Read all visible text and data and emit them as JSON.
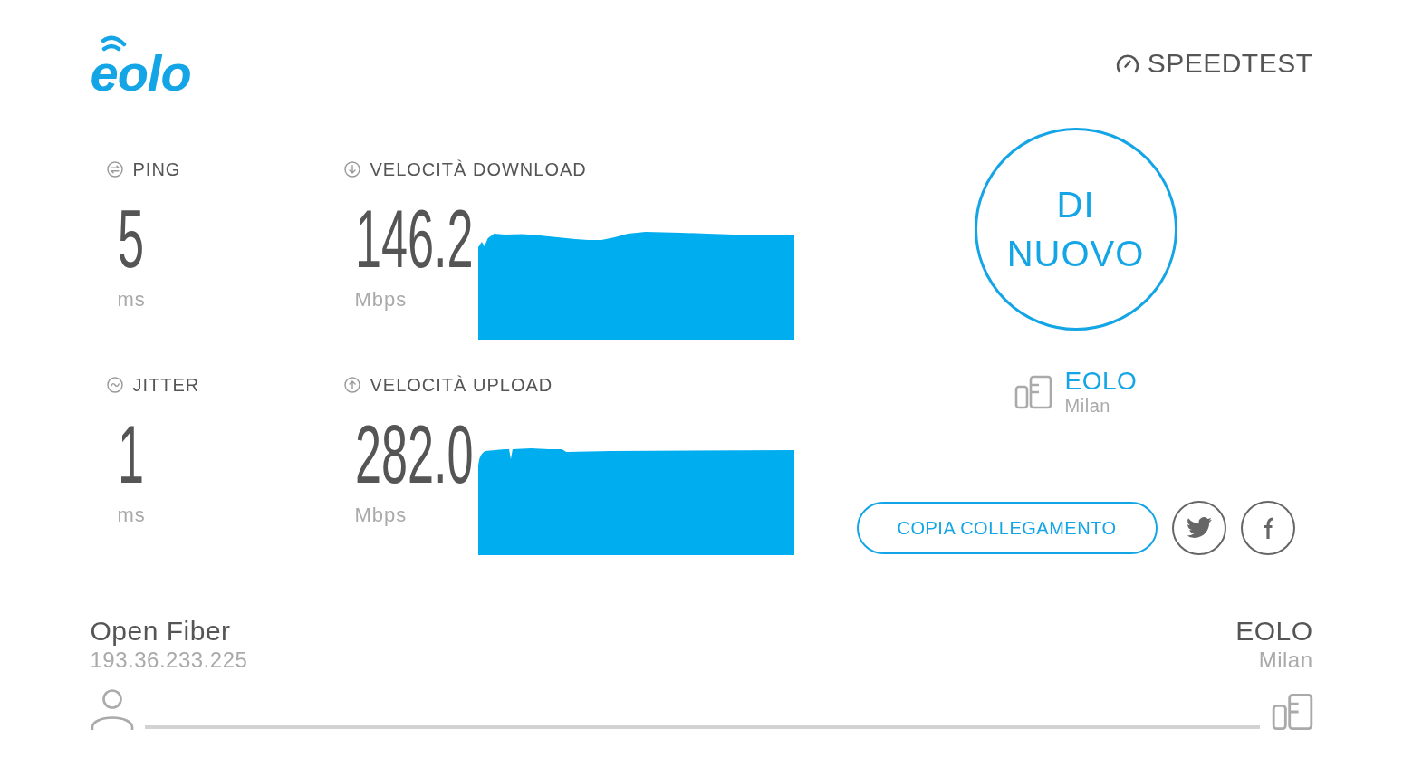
{
  "header": {
    "logo": "eolo",
    "brand": "SPEEDTEST"
  },
  "metrics": [
    {
      "kind": "ping",
      "label": "PING",
      "value": "5",
      "unit": "ms"
    },
    {
      "kind": "download",
      "label": "VELOCITÀ DOWNLOAD",
      "value": "146.2",
      "unit": "Mbps"
    },
    {
      "kind": "jitter",
      "label": "JITTER",
      "value": "1",
      "unit": "ms"
    },
    {
      "kind": "upload",
      "label": "VELOCITÀ UPLOAD",
      "value": "282.0",
      "unit": "Mbps"
    }
  ],
  "restart_button": {
    "label": "DI NUOVO"
  },
  "server": {
    "name": "EOLO",
    "location": "Milan"
  },
  "share": {
    "copy_link_label": "COPIA COLLEGAMENTO",
    "social_buttons": [
      {
        "kind": "twitter"
      },
      {
        "kind": "facebook"
      }
    ]
  },
  "connection": {
    "isp": "Open Fiber",
    "ip": "193.36.233.225",
    "server_name": "EOLO",
    "server_location": "Milan"
  }
}
